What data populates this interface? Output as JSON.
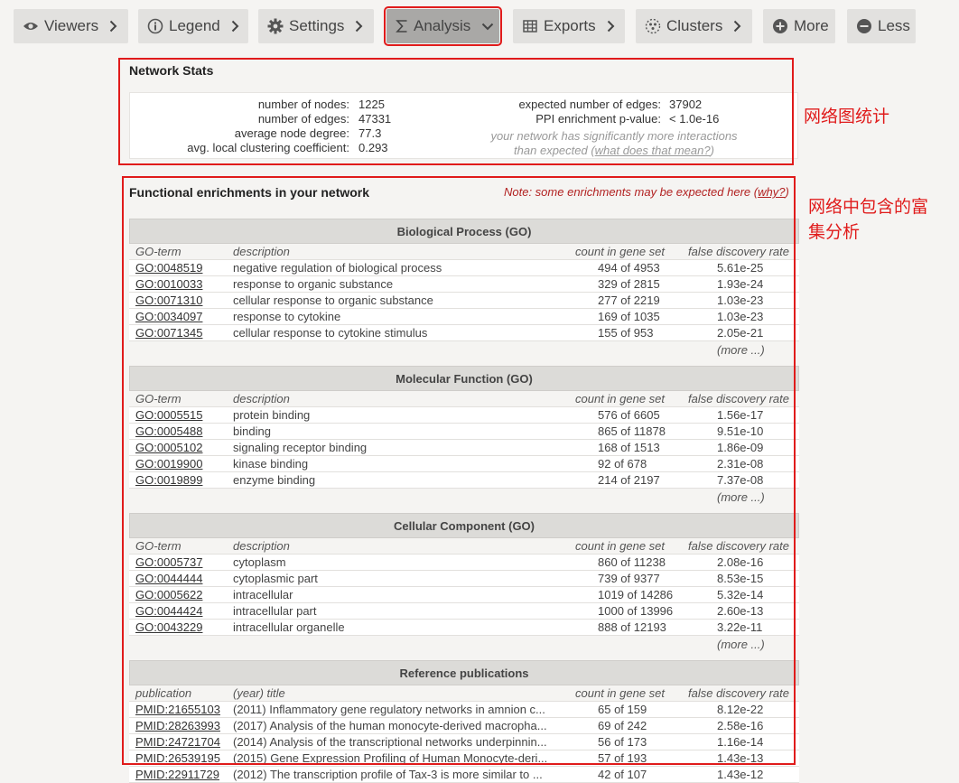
{
  "toolbar": {
    "buttons": [
      {
        "label": "Viewers",
        "icon": "eye-icon"
      },
      {
        "label": "Legend",
        "icon": "info-icon"
      },
      {
        "label": "Settings",
        "icon": "gear-icon"
      },
      {
        "label": "Analysis",
        "icon": "sigma-icon"
      },
      {
        "label": "Exports",
        "icon": "table-icon"
      },
      {
        "label": "Clusters",
        "icon": "cluster-icon"
      },
      {
        "label": "More",
        "icon": "plus-circle-icon"
      },
      {
        "label": "Less",
        "icon": "minus-circle-icon"
      }
    ]
  },
  "network_stats": {
    "title": "Network Stats",
    "left": [
      {
        "label": "number of nodes:",
        "value": "1225"
      },
      {
        "label": "number of edges:",
        "value": "47331"
      },
      {
        "label": "average node degree:",
        "value": "77.3"
      },
      {
        "label": "avg. local clustering coefficient:",
        "value": "0.293"
      }
    ],
    "right": [
      {
        "label": "expected number of edges:",
        "value": "37902"
      },
      {
        "label": "PPI enrichment p-value:",
        "value": "< 1.0e-16"
      }
    ],
    "note_line1": "your network has significantly more interactions",
    "note_line2": "than expected (",
    "note_link": "what does that mean?",
    "note_end": ")"
  },
  "annotations": {
    "stats_note": "网络图统计",
    "enrichment_note_line1": "网络中包含的富",
    "enrichment_note_line2": "集分析"
  },
  "enrichment": {
    "title": "Functional enrichments in your network",
    "note": "Note: some enrichments may be expected here (",
    "note_link": "why?",
    "note_end": ")",
    "more_label": "(more ...)",
    "tables": [
      {
        "heading": "Biological Process (GO)",
        "cols": [
          "GO-term",
          "description",
          "count in gene set",
          "false discovery rate"
        ],
        "rows": [
          [
            "GO:0048519",
            "negative regulation of biological process",
            "494 of 4953",
            "5.61e-25"
          ],
          [
            "GO:0010033",
            "response to organic substance",
            "329 of 2815",
            "1.93e-24"
          ],
          [
            "GO:0071310",
            "cellular response to organic substance",
            "277 of 2219",
            "1.03e-23"
          ],
          [
            "GO:0034097",
            "response to cytokine",
            "169 of 1035",
            "1.03e-23"
          ],
          [
            "GO:0071345",
            "cellular response to cytokine stimulus",
            "155 of 953",
            "2.05e-21"
          ]
        ]
      },
      {
        "heading": "Molecular Function (GO)",
        "cols": [
          "GO-term",
          "description",
          "count in gene set",
          "false discovery rate"
        ],
        "rows": [
          [
            "GO:0005515",
            "protein binding",
            "576 of 6605",
            "1.56e-17"
          ],
          [
            "GO:0005488",
            "binding",
            "865 of 11878",
            "9.51e-10"
          ],
          [
            "GO:0005102",
            "signaling receptor binding",
            "168 of 1513",
            "1.86e-09"
          ],
          [
            "GO:0019900",
            "kinase binding",
            "92 of 678",
            "2.31e-08"
          ],
          [
            "GO:0019899",
            "enzyme binding",
            "214 of 2197",
            "7.37e-08"
          ]
        ]
      },
      {
        "heading": "Cellular Component (GO)",
        "cols": [
          "GO-term",
          "description",
          "count in gene set",
          "false discovery rate"
        ],
        "rows": [
          [
            "GO:0005737",
            "cytoplasm",
            "860 of 11238",
            "2.08e-16"
          ],
          [
            "GO:0044444",
            "cytoplasmic part",
            "739 of 9377",
            "8.53e-15"
          ],
          [
            "GO:0005622",
            "intracellular",
            "1019 of 14286",
            "5.32e-14"
          ],
          [
            "GO:0044424",
            "intracellular part",
            "1000 of 13996",
            "2.60e-13"
          ],
          [
            "GO:0043229",
            "intracellular organelle",
            "888 of 12193",
            "3.22e-11"
          ]
        ]
      },
      {
        "heading": "Reference publications",
        "cols": [
          "publication",
          "(year) title",
          "count in gene set",
          "false discovery rate"
        ],
        "rows": [
          [
            "PMID:21655103",
            "(2011) Inflammatory gene regulatory networks in amnion c...",
            "65 of 159",
            "8.12e-22"
          ],
          [
            "PMID:28263993",
            "(2017) Analysis of the human monocyte-derived macropha...",
            "69 of 242",
            "2.58e-16"
          ],
          [
            "PMID:24721704",
            "(2014) Analysis of the transcriptional networks underpinnin...",
            "56 of 173",
            "1.16e-14"
          ],
          [
            "PMID:26539195",
            "(2015) Gene Expression Profiling of Human Monocyte-deri...",
            "57 of 193",
            "1.43e-13"
          ],
          [
            "PMID:22911729",
            "(2012) The transcription profile of Tax-3 is more similar to ...",
            "42 of 107",
            "1.43e-12"
          ]
        ]
      }
    ]
  }
}
